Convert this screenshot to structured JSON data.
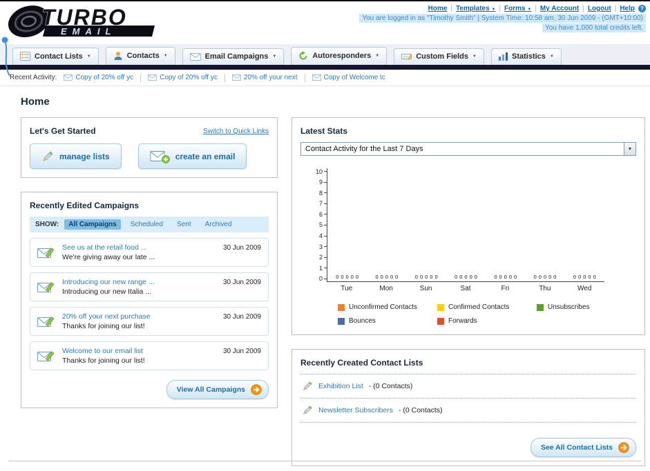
{
  "header": {
    "logo_title": "TURBO",
    "logo_subtitle": "EMAIL",
    "top_links": [
      {
        "label": "Home"
      },
      {
        "label": "Templates"
      },
      {
        "label": "Forms"
      },
      {
        "label": "My Account"
      },
      {
        "label": "Logout"
      },
      {
        "label": "Help"
      }
    ],
    "login_info": "You are logged in as \"Timothy Smith\" | System Time: 10:58 am, 30 Jun 2009 - (GMT+10:00)",
    "credits_info": "You have 1,000 total credits left."
  },
  "nav": {
    "items": [
      {
        "label": "Contact Lists",
        "icon": "contact-lists-icon"
      },
      {
        "label": "Contacts",
        "icon": "contacts-icon"
      },
      {
        "label": "Email Campaigns",
        "icon": "email-campaigns-icon"
      },
      {
        "label": "Autoresponders",
        "icon": "autoresponders-icon"
      },
      {
        "label": "Custom Fields",
        "icon": "custom-fields-icon"
      },
      {
        "label": "Statistics",
        "icon": "statistics-icon"
      }
    ]
  },
  "recent_activity": {
    "label": "Recent Activity:",
    "items": [
      "Copy of 20% off yc",
      "Copy of 20% off yc",
      "20% off your next",
      "Copy of Welcome tc"
    ]
  },
  "page_title": "Home",
  "get_started": {
    "title": "Let's Get Started",
    "switch_link": "Switch to Quick Links",
    "manage_lists_label": "manage lists",
    "create_email_label": "create an email"
  },
  "campaigns": {
    "title": "Recently Edited Campaigns",
    "show_label": "SHOW:",
    "tabs": [
      {
        "label": "All Campaigns",
        "selected": true
      },
      {
        "label": "Scheduled",
        "selected": false
      },
      {
        "label": "Sent",
        "selected": false
      },
      {
        "label": "Archived",
        "selected": false
      }
    ],
    "items": [
      {
        "title": "See us at the retail food ...",
        "subtitle": "We're giving away our late ...",
        "date": "30 Jun 2009"
      },
      {
        "title": "Introducing our new range ...",
        "subtitle": "Introducing our new Italia ...",
        "date": "30 Jun 2009"
      },
      {
        "title": "20% off your next purchase",
        "subtitle": "Thanks for joining our list!",
        "date": "30 Jun 2009"
      },
      {
        "title": "Welcome to our email list",
        "subtitle": "Thanks for joining our list!",
        "date": "30 Jun 2009"
      }
    ],
    "view_all_label": "View All Campaigns"
  },
  "stats": {
    "title": "Latest Stats",
    "dropdown_value": "Contact Activity for the Last 7 Days",
    "chart_data": {
      "type": "bar",
      "title": "Contact Activity for the Last 7 Days",
      "categories": [
        "Tue",
        "Mon",
        "Sun",
        "Sat",
        "Fri",
        "Thu",
        "Wed"
      ],
      "series": [
        {
          "name": "Unconfirmed Contacts",
          "color": "#f58220",
          "values": [
            0,
            0,
            0,
            0,
            0,
            0,
            0
          ]
        },
        {
          "name": "Confirmed Contacts",
          "color": "#ffd100",
          "values": [
            0,
            0,
            0,
            0,
            0,
            0,
            0
          ]
        },
        {
          "name": "Unsubscribes",
          "color": "#5aa31e",
          "values": [
            0,
            0,
            0,
            0,
            0,
            0,
            0
          ]
        },
        {
          "name": "Bounces",
          "color": "#4a6da7",
          "values": [
            0,
            0,
            0,
            0,
            0,
            0,
            0
          ]
        },
        {
          "name": "Forwards",
          "color": "#e84e1b",
          "values": [
            0,
            0,
            0,
            0,
            0,
            0,
            0
          ]
        }
      ],
      "ylim": [
        0,
        10
      ],
      "ytick_step": 1,
      "grid": false,
      "legend_position": "bottom"
    }
  },
  "contact_lists": {
    "title": "Recently Created Contact Lists",
    "items": [
      {
        "name": "Exhibition List",
        "count": "- (0 Contacts)"
      },
      {
        "name": "Newsletter Subscribers",
        "count": "- (0 Contacts)"
      }
    ],
    "see_all_label": "See All Contact Lists"
  },
  "colors": {
    "link_blue": "#2b7bb9",
    "dark_bar": "#14152e",
    "button_text": "#1b6ea5",
    "orange_accent": "#f7941d"
  }
}
